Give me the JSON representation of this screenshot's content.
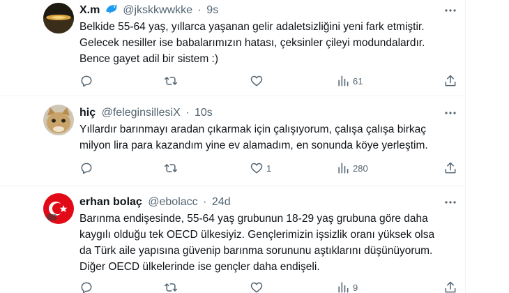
{
  "tweets": [
    {
      "name": "X.m",
      "handle": "@jkskkwwkke",
      "time": "9s",
      "lines": [
        "Belkide 55-64 yaş, yıllarca yaşanan gelir adaletsizliğini yeni fark etmiştir.",
        "Gelecek nesiller ise babalarımızın hatası, çeksinler çileyi modundalardır.",
        "Bence gayet adil bir sistem :)"
      ],
      "likes": "",
      "views": "61"
    },
    {
      "name": "hiç",
      "handle": "@feleginsillesiX",
      "time": "10s",
      "lines": [
        "Yıllardır barınmayı aradan çıkarmak için çalışıyorum, çalışa çalışa birkaç",
        "milyon lira para kazandım yine ev alamadım, en sonunda köye yerleştim."
      ],
      "likes": "1",
      "views": "280"
    },
    {
      "name": "erhan bolaç",
      "handle": "@ebolacc",
      "time": "24d",
      "lines": [
        "Barınma endişesinde, 55-64 yaş grubunun 18-29 yaş grubuna göre daha",
        "kaygılı olduğu tek OECD ülkesiyiz. Gençlerimizin işsizlik oranı yüksek olsa",
        "da Türk aile yapısına güvenip barınma sorununu aştıklarını düşünüyorum.",
        "Diğer OECD ülkelerinde ise gençler daha endişeli."
      ],
      "likes": "",
      "views": "9"
    }
  ],
  "separator": "·",
  "icons": {
    "badge": "dolphin-emoji-icon",
    "more": "more-dots-icon",
    "reply": "reply-icon",
    "retweet": "retweet-icon",
    "like": "heart-icon",
    "views": "views-chart-icon",
    "share": "share-icon"
  },
  "colors": {
    "text": "#0f1419",
    "secondary": "#536471",
    "divider": "#eff3f4",
    "badge": "#1d9bf0"
  }
}
